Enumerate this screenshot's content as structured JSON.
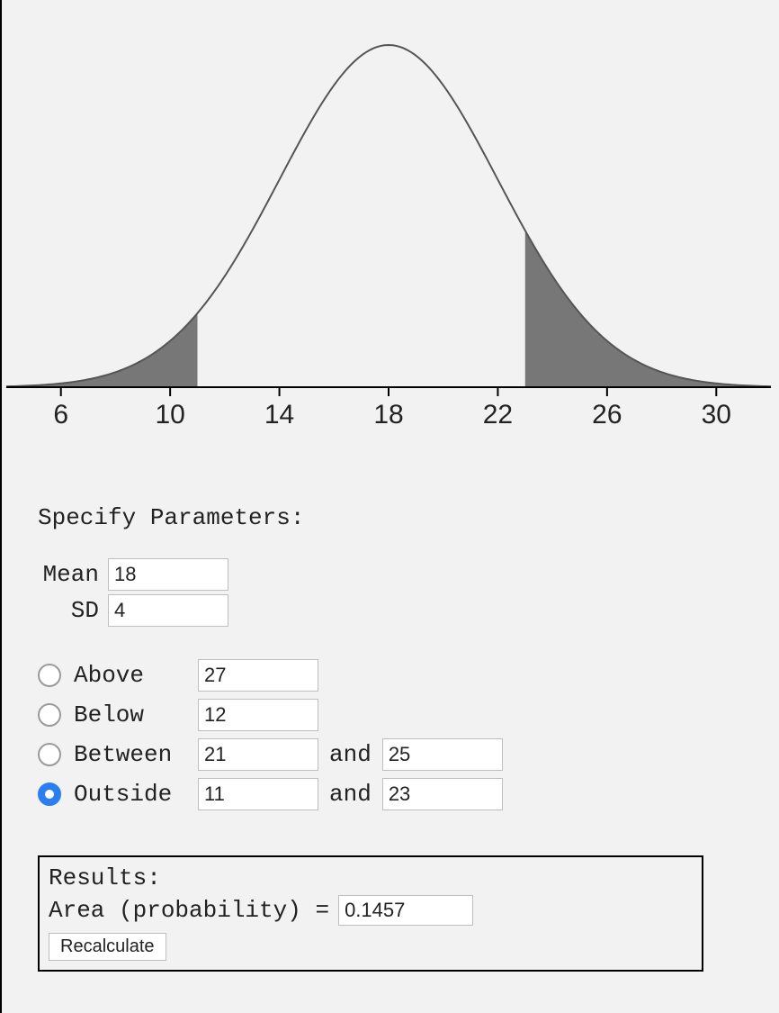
{
  "chart_data": {
    "type": "area",
    "distribution": "normal",
    "mean": 18,
    "sd": 4,
    "x_ticks": [
      6,
      10,
      14,
      18,
      22,
      26,
      30
    ],
    "x_range": [
      4,
      32
    ],
    "shaded_regions": [
      {
        "from": 4,
        "to": 11
      },
      {
        "from": 23,
        "to": 32
      }
    ],
    "title": "",
    "xlabel": "",
    "ylabel": ""
  },
  "params": {
    "title": "Specify Parameters:",
    "mean_label": "Mean",
    "mean_value": "18",
    "sd_label": "SD",
    "sd_value": "4"
  },
  "options": {
    "above": {
      "label": "Above",
      "value": "27",
      "checked": false
    },
    "below": {
      "label": "Below",
      "value": "12",
      "checked": false
    },
    "between": {
      "label": "Between",
      "a": "21",
      "and_label": "and",
      "b": "25",
      "checked": false
    },
    "outside": {
      "label": "Outside",
      "a": "11",
      "and_label": "and",
      "b": "23",
      "checked": true
    }
  },
  "results": {
    "title": "Results:",
    "area_label": "Area (probability) =",
    "area_value": "0.1457",
    "recalc_label": "Recalculate"
  }
}
